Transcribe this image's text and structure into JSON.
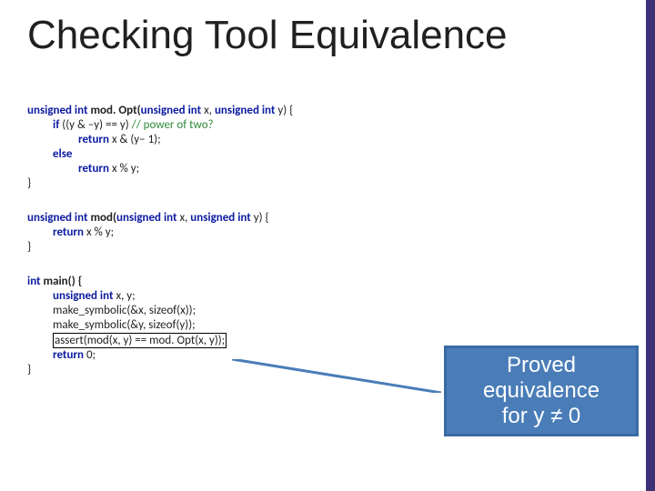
{
  "title": "Checking Tool Equivalence",
  "code1": {
    "sig_kw1": "unsigned int",
    "sig_fn": " mod. Opt(",
    "sig_p1": "unsigned int",
    "sig_mid1": " x, ",
    "sig_p2": "unsigned int",
    "sig_mid2": " y) {",
    "l2_kw": "if",
    "l2_rest": " ((y & –y) == y) ",
    "l2_cm": "// power of two?",
    "l3_kw": "return",
    "l3_rest": " x & (y– 1);",
    "l4_kw": "else",
    "l5_kw": "return",
    "l5_rest": " x % y;",
    "close": "}"
  },
  "code2": {
    "sig_kw1": "unsigned int",
    "sig_fn": " mod(",
    "sig_p1": "unsigned int",
    "sig_mid1": " x, ",
    "sig_p2": "unsigned int",
    "sig_mid2": " y) {",
    "l2_kw": "return",
    "l2_rest": " x % y;",
    "close": "}"
  },
  "code3": {
    "sig_kw1": "int",
    "sig_fn": " main() {",
    "l2_kw": "unsigned int",
    "l2_rest": " x, y;",
    "l3": "make_symbolic(&x, sizeof(x));",
    "l4": "make_symbolic(&y, sizeof(y));",
    "l5": "assert(mod(x, y) == mod. Opt(x, y));",
    "l6_kw": "return",
    "l6_rest": " 0;",
    "close": "}"
  },
  "callout": {
    "line1": "Proved",
    "line2": "equivalence",
    "line3": "for y ≠ 0"
  }
}
